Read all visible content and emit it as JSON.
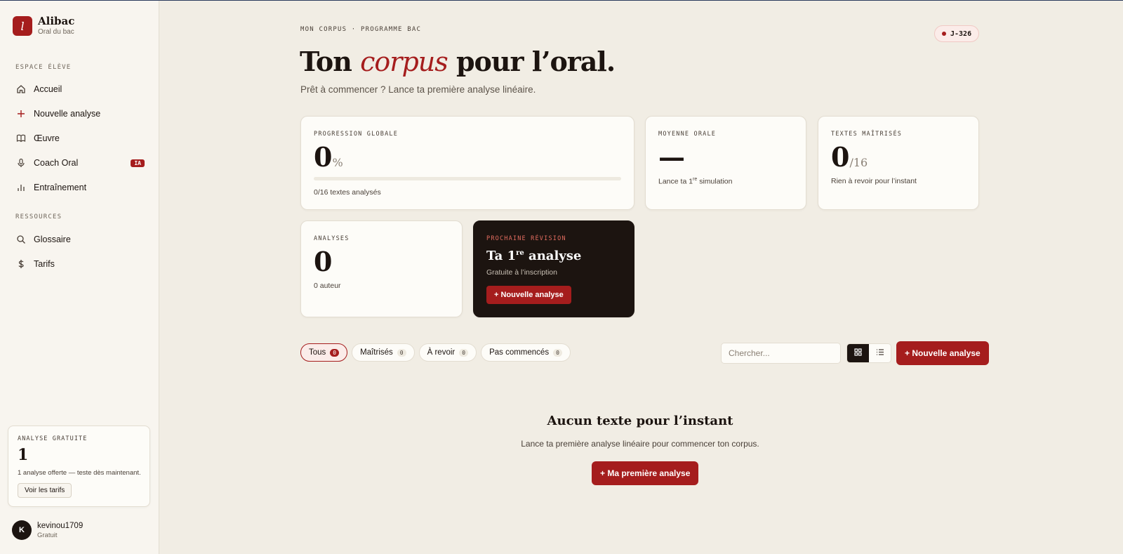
{
  "brand": {
    "logo_letter": "l",
    "name": "Alibac",
    "subtitle": "Oral du bac"
  },
  "sidebar": {
    "section_student": "ESPACE ÉLÈVE",
    "items": [
      {
        "label": "Accueil",
        "icon": "home-icon"
      },
      {
        "label": "Nouvelle analyse",
        "icon": "plus-icon"
      },
      {
        "label": "Œuvre",
        "icon": "book-icon"
      },
      {
        "label": "Coach Oral",
        "icon": "mic-icon",
        "badge": "IA"
      },
      {
        "label": "Entraînement",
        "icon": "bar-chart-icon"
      }
    ],
    "section_resources": "RESSOURCES",
    "resources": [
      {
        "label": "Glossaire",
        "icon": "search-icon"
      },
      {
        "label": "Tarifs",
        "icon": "dollar-icon"
      }
    ],
    "free_card": {
      "label": "ANALYSE GRATUITE",
      "count": "1",
      "description": "1 analyse offerte — teste dès maintenant.",
      "button": "Voir les tarifs"
    },
    "user": {
      "initial": "K",
      "name": "kevinou1709",
      "plan": "Gratuit"
    }
  },
  "header": {
    "eyebrow": "MON CORPUS · PROGRAMME BAC",
    "countdown": "J-326",
    "title_before": "Ton ",
    "title_accent": "corpus",
    "title_after": " pour l’oral.",
    "subtitle": "Prêt à commencer ? Lance ta première analyse linéaire."
  },
  "stats": {
    "progress": {
      "label": "PROGRESSION GLOBALE",
      "value": "0",
      "unit": "%",
      "fraction": 0,
      "caption": "0/16 textes analysés"
    },
    "average": {
      "label": "MOYENNE ORALE",
      "value": "—",
      "caption_pre": "Lance ta 1",
      "caption_sup": "re",
      "caption_post": " simulation"
    },
    "mastered": {
      "label": "TEXTES MAÎTRISÉS",
      "value": "0",
      "total": "/16",
      "caption": "Rien à revoir pour l’instant"
    },
    "analyses": {
      "label": "ANALYSES",
      "value": "0",
      "caption": "0 auteur"
    },
    "next": {
      "label": "PROCHAINE RÉVISION",
      "title_pre": "Ta 1",
      "title_sup": "re",
      "title_post": " analyse",
      "subtitle": "Gratuite à l’inscription",
      "button": "+ Nouvelle analyse"
    }
  },
  "filters": [
    {
      "label": "Tous",
      "count": "0",
      "active": true
    },
    {
      "label": "Maîtrisés",
      "count": "0"
    },
    {
      "label": "À revoir",
      "count": "0"
    },
    {
      "label": "Pas commencés",
      "count": "0"
    }
  ],
  "toolbar": {
    "search_placeholder": "Chercher...",
    "new_button": "+ Nouvelle analyse"
  },
  "empty": {
    "title": "Aucun texte pour l’instant",
    "description": "Lance ta première analyse linéaire pour commencer ton corpus.",
    "button": "+ Ma première analyse"
  },
  "colors": {
    "accent": "#a51d1d",
    "dark": "#1c1410",
    "background": "#f1ede4"
  }
}
